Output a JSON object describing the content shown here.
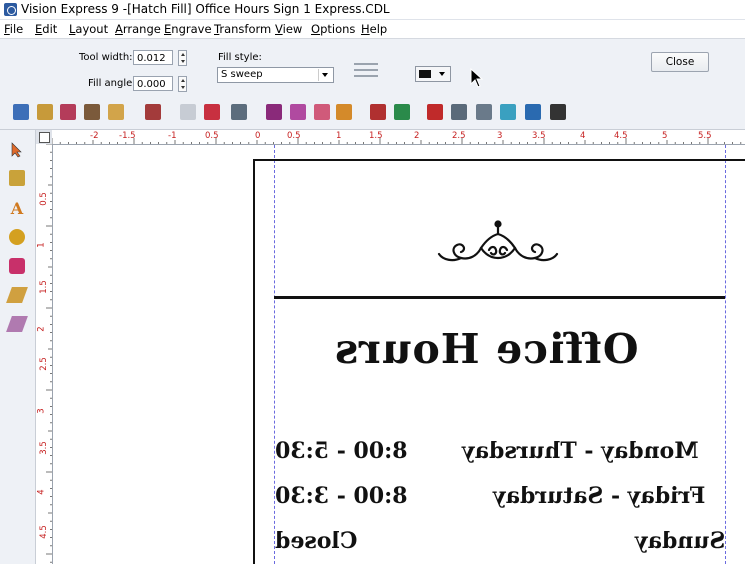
{
  "window": {
    "title": "Vision Express 9 -[Hatch Fill] Office Hours Sign 1 Express.CDL"
  },
  "menu": [
    "File",
    "Edit",
    "Layout",
    "Arrange",
    "Engrave",
    "Transform",
    "View",
    "Options",
    "Help"
  ],
  "props": {
    "tool_width_label": "Tool width:",
    "tool_width_value": "0.012",
    "fill_angle_label": "Fill angle:",
    "fill_angle_value": "0.000",
    "fill_style_label": "Fill style:",
    "fill_style_value": "S sweep",
    "close_label": "Close"
  },
  "ruler": {
    "h_labels": [
      "-2",
      "-1.5",
      "-1",
      "0.5",
      "0",
      "0.5",
      "1",
      "1.5",
      "2",
      "2.5",
      "3",
      "3.5",
      "4",
      "4.5",
      "5",
      "5.5"
    ],
    "v_labels": [
      "0.5",
      "1",
      "1.5",
      "2",
      "2.5",
      "3",
      "3.5",
      "4",
      "4.5"
    ]
  },
  "sign": {
    "title": "Office Hours",
    "rows": [
      {
        "day": "Monday - Thursday",
        "time": "8:00 - 5:30"
      },
      {
        "day": "Friday - Saturday",
        "time": "8:00 - 3:30"
      },
      {
        "day": "Sunday",
        "time": "Closed"
      }
    ]
  },
  "icons": {
    "toolbar": [
      "new-icon",
      "open-icon",
      "save-icon",
      "save-as-icon",
      "print-icon",
      "engrave-icon",
      "undo-icon",
      "eraser-icon",
      "clipboard-icon",
      "cut-icon",
      "copy-icon",
      "paste-icon",
      "fill-icon",
      "gallery-icon",
      "export-icon",
      "delete-icon",
      "node-icon",
      "weld-icon",
      "shape-icon",
      "window-icon",
      "pan-icon"
    ],
    "toolbox": [
      "pointer-icon",
      "node-edit-icon",
      "text-tool-icon",
      "zoom-icon",
      "fill-tool-icon",
      "pencil-icon",
      "pen-icon"
    ]
  },
  "colors": {
    "accent": "#2c5aa0",
    "ruler_label": "#c62020",
    "guide": "#6a6adf"
  }
}
